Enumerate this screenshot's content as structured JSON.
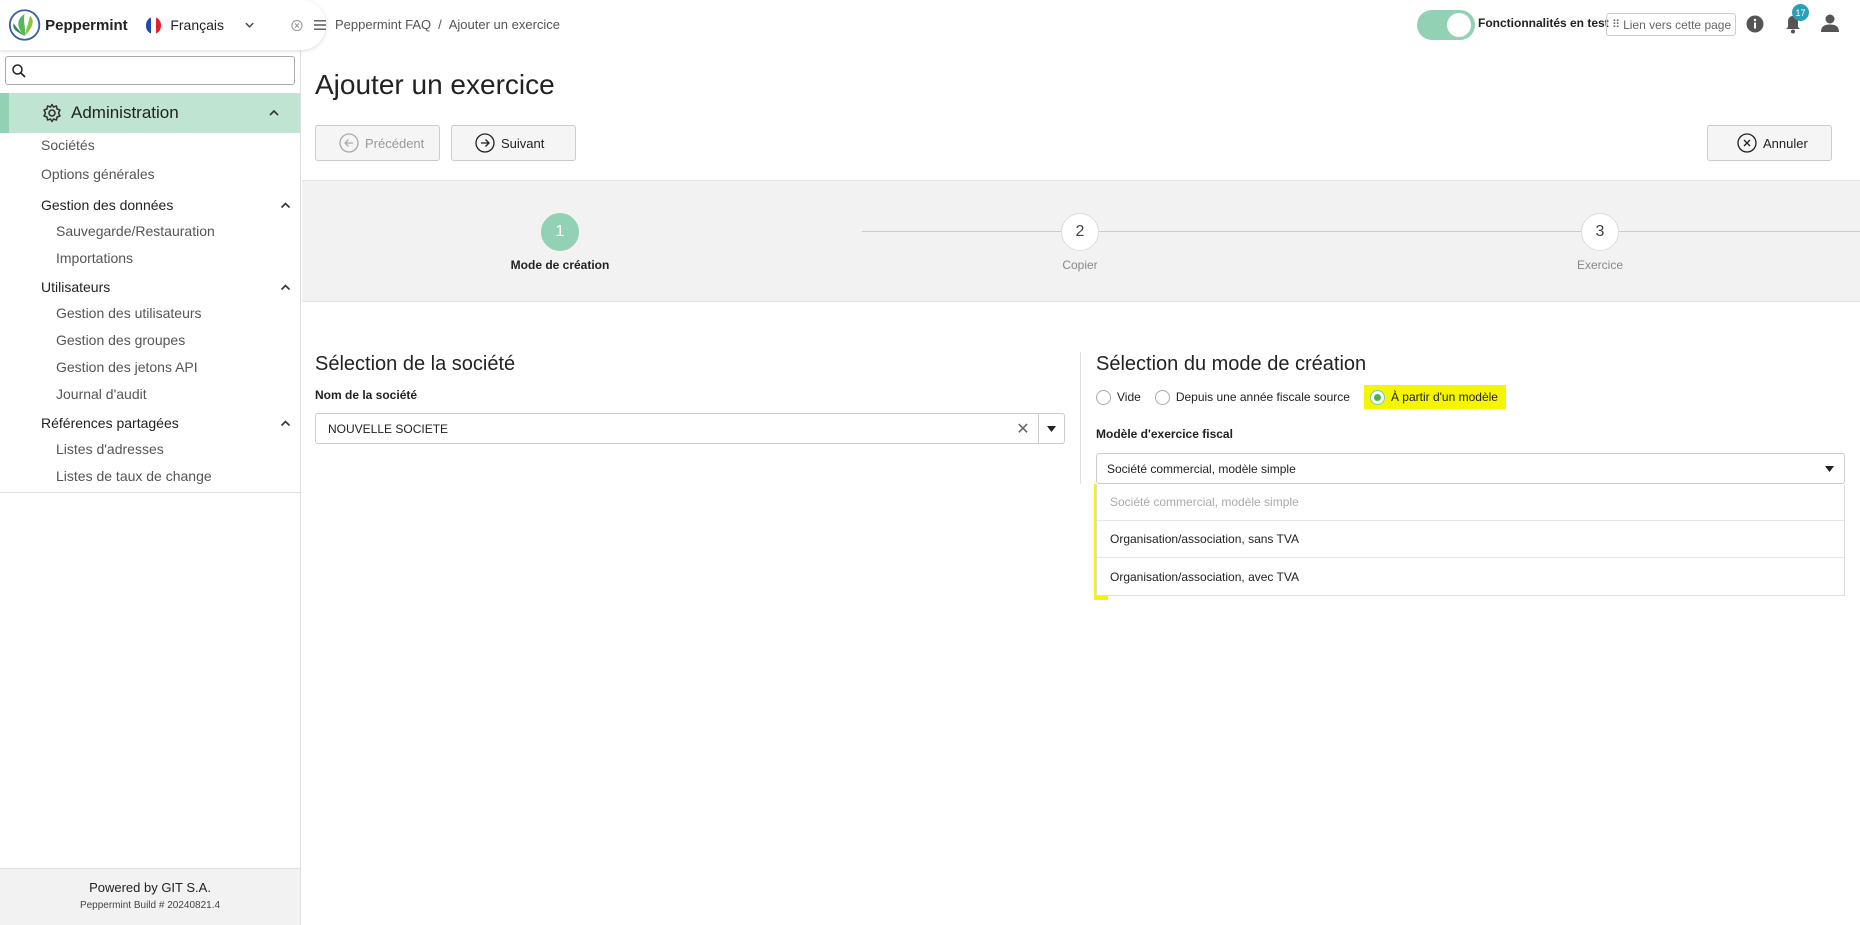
{
  "app": {
    "name": "Peppermint",
    "language": "Français",
    "colors": {
      "accent": "#93d1b4",
      "highlight": "#f5f500",
      "badge": "#2a9fb5"
    }
  },
  "header": {
    "breadcrumb": {
      "root": "Peppermint FAQ",
      "separator": "/",
      "current": "Ajouter un exercice"
    },
    "toggle_label": "Fonctionnalités en test",
    "link_button": "Lien vers cette page",
    "notifications_count": "17"
  },
  "sidebar": {
    "search_placeholder": "",
    "admin_label": "Administration",
    "items": {
      "societes": "Sociétés",
      "options": "Options générales",
      "gestion_donnees": "Gestion des données",
      "sauvegarde": "Sauvegarde/Restauration",
      "importations": "Importations",
      "utilisateurs": "Utilisateurs",
      "gestion_utilisateurs": "Gestion des utilisateurs",
      "gestion_groupes": "Gestion des groupes",
      "gestion_jetons": "Gestion des jetons API",
      "journal": "Journal d'audit",
      "references": "Références partagées",
      "listes_adresses": "Listes d'adresses",
      "listes_taux": "Listes de taux de change"
    },
    "footer": {
      "powered": "Powered by GIT S.A.",
      "build": "Peppermint Build # 20240821.4"
    }
  },
  "main": {
    "title": "Ajouter un exercice",
    "buttons": {
      "prev": "Précédent",
      "next": "Suivant",
      "cancel": "Annuler"
    },
    "steps": [
      {
        "num": "1",
        "label": "Mode de création"
      },
      {
        "num": "2",
        "label": "Copier"
      },
      {
        "num": "3",
        "label": "Exercice"
      }
    ],
    "left": {
      "title": "Sélection de la société",
      "field_label": "Nom de la société",
      "field_value": "NOUVELLE SOCIETE"
    },
    "right": {
      "title": "Sélection du mode de création",
      "radios": [
        "Vide",
        "Depuis une année fiscale source",
        "À partir d'un modèle"
      ],
      "field_label": "Modèle d'exercice fiscal",
      "field_value": "Société commercial, modèle simple",
      "options": [
        "Société commercial, modèle simple",
        "Organisation/association, sans TVA",
        "Organisation/association, avec TVA"
      ]
    }
  }
}
